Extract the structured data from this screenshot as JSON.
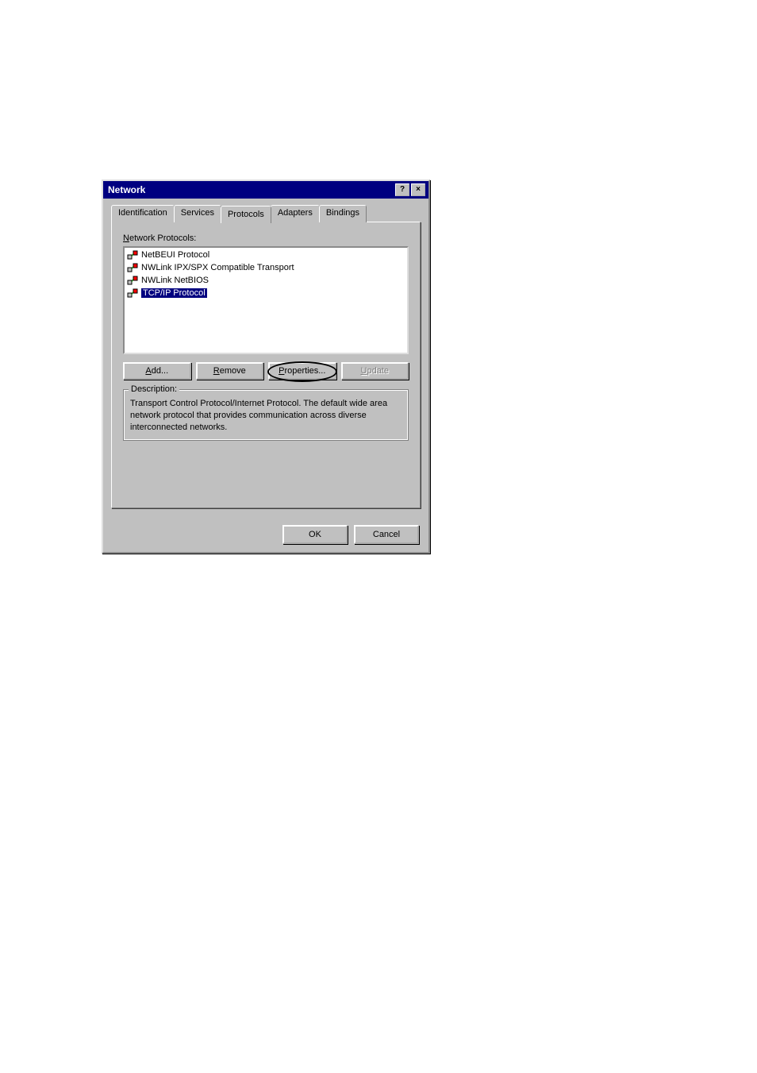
{
  "window": {
    "title": "Network",
    "help_glyph": "?",
    "close_glyph": "×"
  },
  "tabs": {
    "identification": "Identification",
    "services": "Services",
    "protocols": "Protocols",
    "adapters": "Adapters",
    "bindings": "Bindings"
  },
  "panel": {
    "list_label_pre": "N",
    "list_label_rest": "etwork Protocols:",
    "protocols": [
      {
        "name": "NetBEUI Protocol",
        "selected": false
      },
      {
        "name": "NWLink IPX/SPX Compatible Transport",
        "selected": false
      },
      {
        "name": "NWLink NetBIOS",
        "selected": false
      },
      {
        "name": "TCP/IP Protocol",
        "selected": true
      }
    ],
    "buttons": {
      "add_u": "A",
      "add_rest": "dd...",
      "remove_u": "R",
      "remove_rest": "emove",
      "properties_u": "P",
      "properties_rest": "roperties...",
      "update_u": "U",
      "update_rest": "pdate"
    },
    "description_title": "Description:",
    "description_text": "Transport Control Protocol/Internet Protocol. The default wide area network protocol that provides communication across diverse interconnected networks."
  },
  "footer": {
    "ok": "OK",
    "cancel": "Cancel"
  }
}
